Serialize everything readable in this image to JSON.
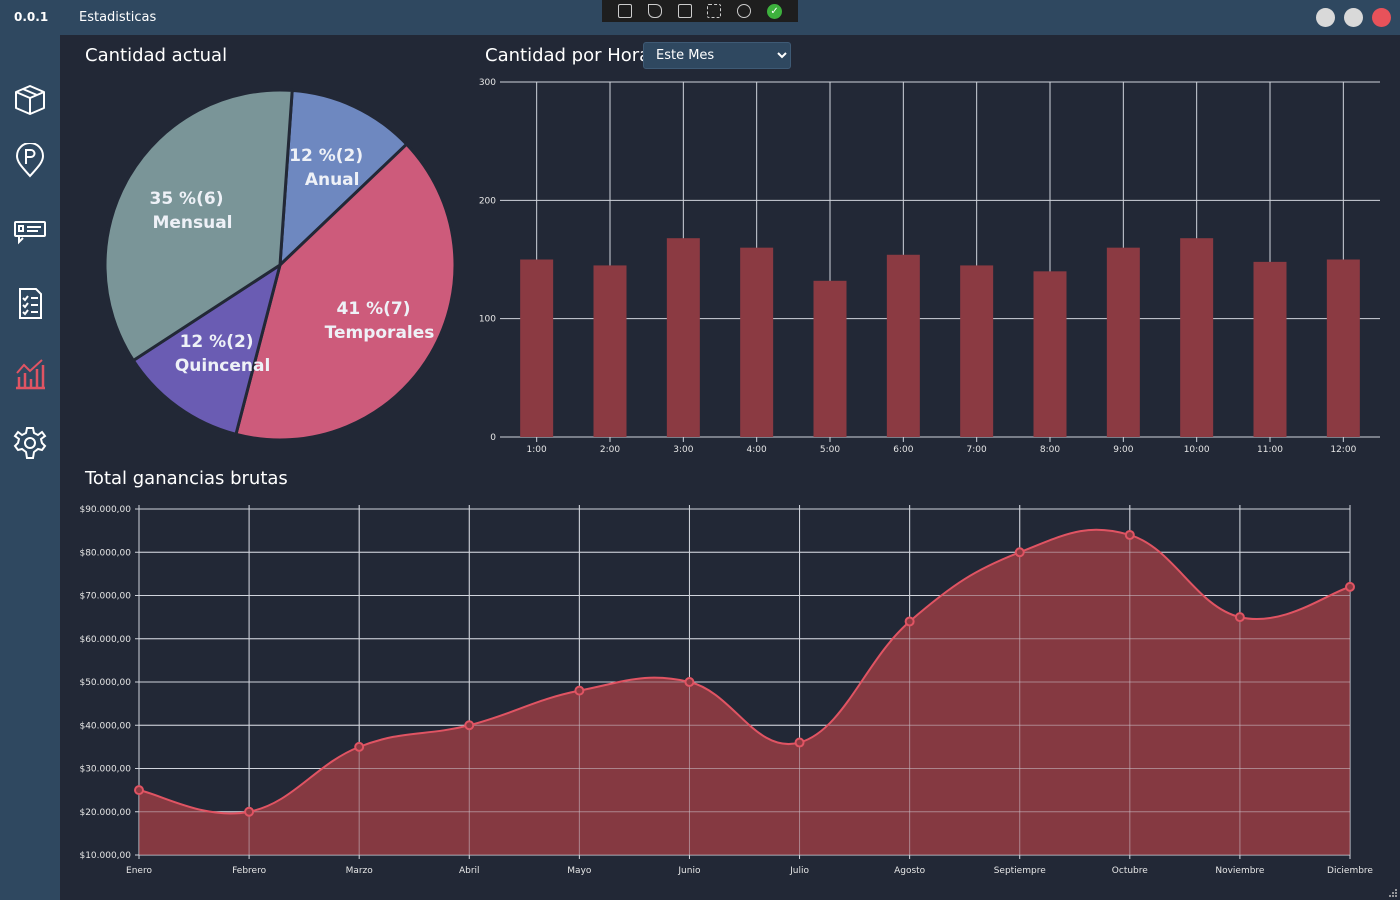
{
  "titlebar": {
    "version": "0.0.1",
    "title": "Estadisticas"
  },
  "debug_toolbar": {
    "icons": [
      "select-element-icon",
      "pointer-icon",
      "layout-adorner-icon",
      "track-focus-icon",
      "hot-reload-icon",
      "binding-ok-icon"
    ]
  },
  "window_controls": {
    "minimize_color": "#d9d9d9",
    "maximize_color": "#d9d9d9",
    "close_color": "#e8525a"
  },
  "sidebar": {
    "items": [
      {
        "icon": "cube-icon"
      },
      {
        "icon": "parking-pin-icon"
      },
      {
        "icon": "ticket-icon"
      },
      {
        "icon": "checklist-icon"
      },
      {
        "icon": "bar-chart-icon",
        "active": true
      },
      {
        "icon": "gear-icon"
      }
    ]
  },
  "pie_panel": {
    "title": "Cantidad actual"
  },
  "bar_panel": {
    "title": "Cantidad por Hora",
    "period_selected": "Este Mes"
  },
  "line_panel": {
    "title": "Total ganancias brutas"
  },
  "colors": {
    "accent": "#e05463",
    "bar_fill": "#8b3a42",
    "area_fill": "#8b3a42",
    "pie_anual": "#6e88c0",
    "pie_temporales": "#cd5b7b",
    "pie_quincenal": "#6a5cb3",
    "pie_mensual": "#7a9598"
  },
  "chart_data": [
    {
      "type": "pie",
      "title": "Cantidad actual",
      "slices": [
        {
          "label": "Anual",
          "value": 2,
          "percent_label": "12 %(2)",
          "color": "#6e88c0"
        },
        {
          "label": "Temporales",
          "value": 7,
          "percent_label": "41 %(7)",
          "color": "#cd5b7b"
        },
        {
          "label": "Quincenal",
          "value": 2,
          "percent_label": "12 %(2)",
          "color": "#6a5cb3"
        },
        {
          "label": "Mensual",
          "value": 6,
          "percent_label": "35 %(6)",
          "color": "#7a9598"
        }
      ]
    },
    {
      "type": "bar",
      "title": "Cantidad por Hora",
      "categories": [
        "1:00",
        "2:00",
        "3:00",
        "4:00",
        "5:00",
        "6:00",
        "7:00",
        "8:00",
        "9:00",
        "10:00",
        "11:00",
        "12:00"
      ],
      "values": [
        150,
        145,
        168,
        160,
        132,
        154,
        145,
        140,
        160,
        168,
        148,
        150
      ],
      "ylim": [
        0,
        300
      ],
      "yticks": [
        "0",
        "100",
        "200",
        "300"
      ],
      "grid": true
    },
    {
      "type": "area",
      "title": "Total ganancias brutas",
      "categories": [
        "Enero",
        "Febrero",
        "Marzo",
        "Abril",
        "Mayo",
        "Junio",
        "Julio",
        "Agosto",
        "Septiempre",
        "Octubre",
        "Noviembre",
        "Diciembre"
      ],
      "values": [
        25000,
        20000,
        35000,
        40000,
        48000,
        50000,
        36000,
        64000,
        80000,
        84000,
        65000,
        72000
      ],
      "ylim": [
        10000,
        90000
      ],
      "yticks": [
        "$10.000,00",
        "$20.000,00",
        "$30.000,00",
        "$40.000,00",
        "$50.000,00",
        "$60.000,00",
        "$70.000,00",
        "$80.000,00",
        "$90.000,00"
      ],
      "grid": true
    }
  ]
}
